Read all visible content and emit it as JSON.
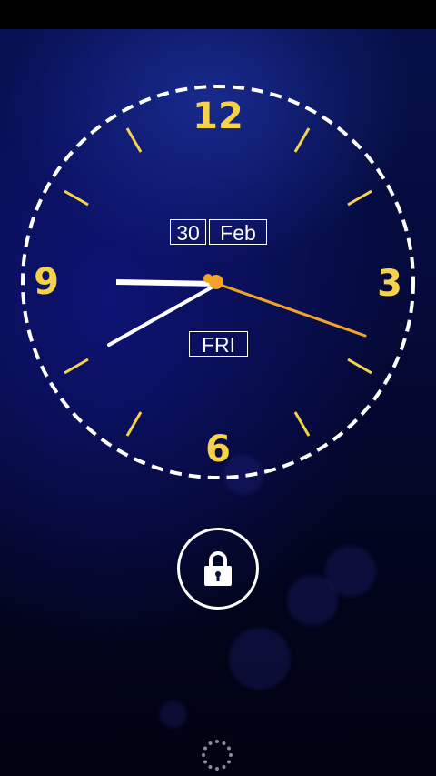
{
  "clock": {
    "numerals": {
      "twelve": "12",
      "three": "3",
      "six": "6",
      "nine": "9"
    },
    "day_of_month": "30",
    "month": "Feb",
    "weekday": "FRI",
    "accent_color": "#f6d24a",
    "second_hand_color": "#f2a42a",
    "hand_color": "#ffffff"
  },
  "lock": {
    "icon": "lock-icon"
  },
  "navigation": {
    "icon": "loading-spinner-icon"
  },
  "colors": {
    "background_top": "#06104a",
    "background_bottom": "#010210",
    "status_bar": "#000000"
  }
}
